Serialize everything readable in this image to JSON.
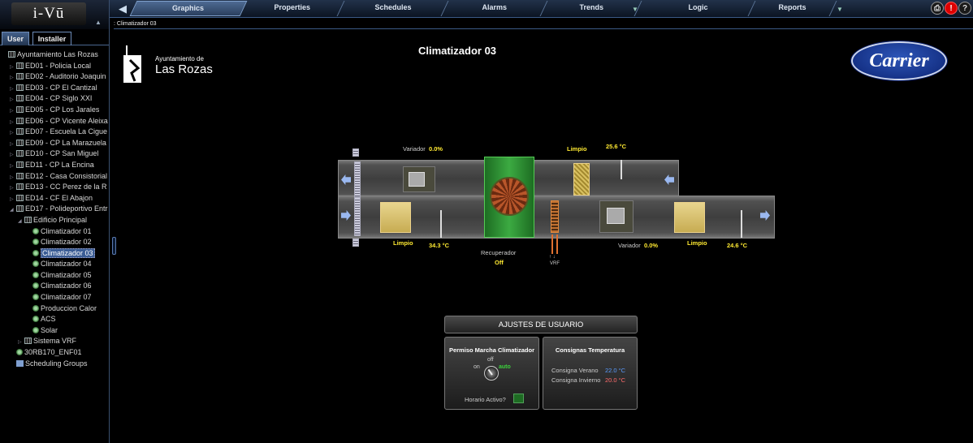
{
  "app": {
    "logo_text": "i-Vū"
  },
  "nav": {
    "tabs": [
      {
        "label": "Graphics",
        "active": true
      },
      {
        "label": "Properties",
        "active": false
      },
      {
        "label": "Schedules",
        "active": false
      },
      {
        "label": "Alarms",
        "active": false
      },
      {
        "label": "Trends",
        "active": false
      },
      {
        "label": "Logic",
        "active": false
      },
      {
        "label": "Reports",
        "active": false
      }
    ]
  },
  "breadcrumb": ": Climatizador 03",
  "sidebar": {
    "tabs": [
      "User",
      "Installer"
    ],
    "tree": [
      {
        "label": "Ayuntamiento Las Rozas",
        "level": 0,
        "icon": "building-icon",
        "exp": ""
      },
      {
        "label": "ED01 - Policia Local",
        "level": 1,
        "icon": "building-icon",
        "exp": "▷"
      },
      {
        "label": "ED02 - Auditorio Joaquin",
        "level": 1,
        "icon": "building-icon",
        "exp": "▷"
      },
      {
        "label": "ED03 - CP El Cantizal",
        "level": 1,
        "icon": "building-icon",
        "exp": "▷"
      },
      {
        "label": "ED04 - CP Siglo XXI",
        "level": 1,
        "icon": "building-icon",
        "exp": "▷"
      },
      {
        "label": "ED05 - CP Los Jarales",
        "level": 1,
        "icon": "building-icon",
        "exp": "▷"
      },
      {
        "label": "ED06 - CP Vicente Aleixa",
        "level": 1,
        "icon": "building-icon",
        "exp": "▷"
      },
      {
        "label": "ED07 - Escuela La Cigue",
        "level": 1,
        "icon": "building-icon",
        "exp": "▷"
      },
      {
        "label": "ED09 - CP La Marazuela",
        "level": 1,
        "icon": "building-icon",
        "exp": "▷"
      },
      {
        "label": "ED10 - CP San Miguel",
        "level": 1,
        "icon": "building-icon",
        "exp": "▷"
      },
      {
        "label": "ED11 - CP La Encina",
        "level": 1,
        "icon": "building-icon",
        "exp": "▷"
      },
      {
        "label": "ED12 - Casa Consistorial",
        "level": 1,
        "icon": "building-icon",
        "exp": "▷"
      },
      {
        "label": "ED13 - CC Perez de la R",
        "level": 1,
        "icon": "building-icon",
        "exp": "▷"
      },
      {
        "label": "ED14 - CF El Abajon",
        "level": 1,
        "icon": "building-icon",
        "exp": "▷"
      },
      {
        "label": "ED17 - Polideportivo Entr",
        "level": 1,
        "icon": "building-icon",
        "exp": "◢"
      },
      {
        "label": "Edificio Principal",
        "level": 2,
        "icon": "building-icon",
        "exp": "◢"
      },
      {
        "label": "Climatizador 01",
        "level": 3,
        "icon": "equipment-icon",
        "exp": ""
      },
      {
        "label": "Climatizador 02",
        "level": 3,
        "icon": "equipment-icon",
        "exp": ""
      },
      {
        "label": "Climatizador 03",
        "level": 3,
        "icon": "equipment-icon",
        "exp": "",
        "selected": true
      },
      {
        "label": "Climatizador 04",
        "level": 3,
        "icon": "equipment-icon",
        "exp": ""
      },
      {
        "label": "Climatizador 05",
        "level": 3,
        "icon": "equipment-icon",
        "exp": ""
      },
      {
        "label": "Climatizador 06",
        "level": 3,
        "icon": "equipment-icon",
        "exp": ""
      },
      {
        "label": "Climatizador 07",
        "level": 3,
        "icon": "equipment-icon",
        "exp": ""
      },
      {
        "label": "Produccion Calor",
        "level": 3,
        "icon": "equipment-icon",
        "exp": ""
      },
      {
        "label": "ACS",
        "level": 3,
        "icon": "equipment-icon",
        "exp": ""
      },
      {
        "label": "Solar",
        "level": 3,
        "icon": "equipment-icon",
        "exp": ""
      },
      {
        "label": "Sistema VRF",
        "level": 2,
        "icon": "building-icon",
        "exp": "▷"
      },
      {
        "label": "30RB170_ENF01",
        "level": 1,
        "icon": "equipment-icon",
        "exp": ""
      },
      {
        "label": "Scheduling Groups",
        "level": 1,
        "icon": "folder-icon",
        "exp": ""
      }
    ]
  },
  "header": {
    "org_small": "Ayuntamiento de",
    "org_big": "Las Rozas",
    "title": "Climatizador 03",
    "brand": "Carrier"
  },
  "ahu": {
    "variador_top_label": "Variador",
    "variador_top_value": "0.0%",
    "limpio_top": "Limpio",
    "temp_top": "25.6 °C",
    "limpio_left": "Limpio",
    "temp_left": "34.3 °C",
    "recuperador_label": "Recuperador",
    "recuperador_value": "Off",
    "vrf_label": "VRF",
    "vrf_arrows": "↑ ↓",
    "variador_bottom_label": "Variador",
    "variador_bottom_value": "0.0%",
    "limpio_right": "Limpio",
    "temp_right": "24.6 °C"
  },
  "settings": {
    "title": "AJUSTES DE USUARIO",
    "permiso": {
      "title": "Permiso Marcha Climatizador",
      "off": "off",
      "on": "on",
      "auto": "auto",
      "horario": "Horario Activo?"
    },
    "consignas": {
      "title": "Consignas Temperatura",
      "verano_label": "Consigna Verano",
      "verano_value": "22.0 °C",
      "invierno_label": "Consigna Invierno",
      "invierno_value": "20.0 °C"
    }
  },
  "colors": {
    "accent": "#3b5a86",
    "value_yellow": "#ffea32",
    "verano": "#5a9cff",
    "invierno": "#ff6b6b",
    "auto_green": "#3cd23c"
  }
}
